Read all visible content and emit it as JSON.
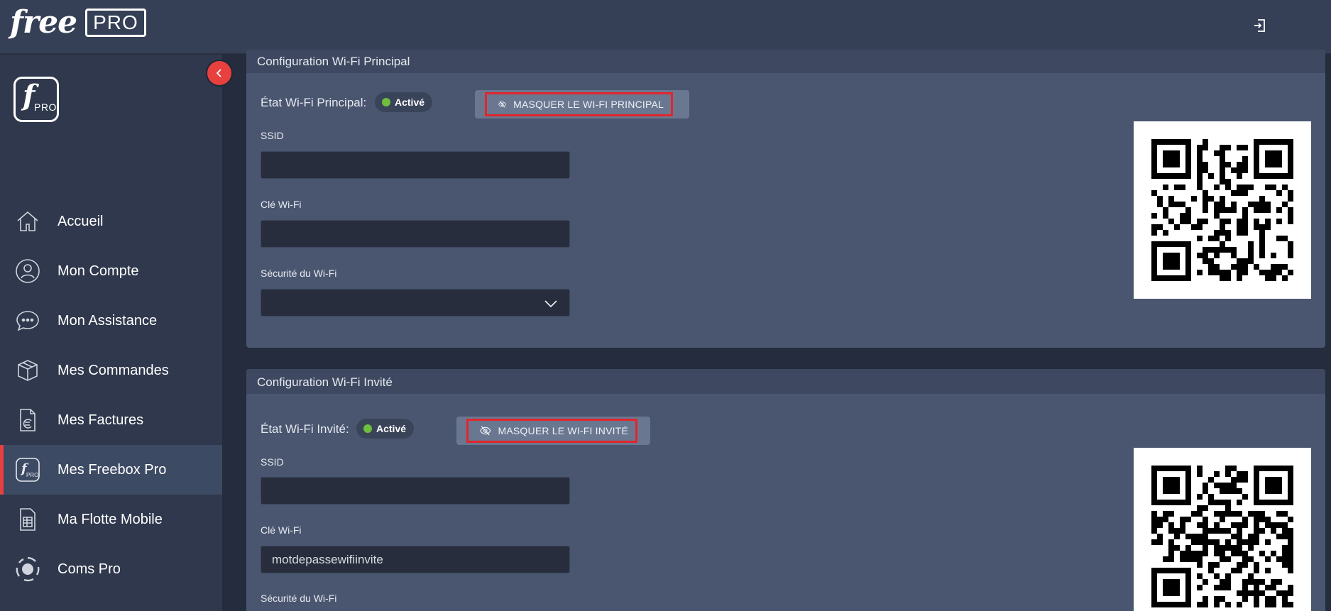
{
  "header": {
    "brand_free": "free",
    "brand_pro": "PRO",
    "logout_icon": "logout-icon"
  },
  "sidebar": {
    "logo_f": "f",
    "logo_pro": "PRO",
    "collapse_icon": "chevron-left-icon",
    "items": [
      {
        "label": "Accueil",
        "icon": "home-icon",
        "active": false
      },
      {
        "label": "Mon Compte",
        "icon": "user-icon",
        "active": false
      },
      {
        "label": "Mon Assistance",
        "icon": "chat-icon",
        "active": false
      },
      {
        "label": "Mes Commandes",
        "icon": "box-icon",
        "active": false
      },
      {
        "label": "Mes Factures",
        "icon": "invoice-euro-icon",
        "active": false
      },
      {
        "label": "Mes Freebox Pro",
        "icon": "freebox-pro-icon",
        "active": true
      },
      {
        "label": "Ma Flotte Mobile",
        "icon": "sim-card-icon",
        "active": false
      },
      {
        "label": "Coms Pro",
        "icon": "coms-icon",
        "active": false
      }
    ]
  },
  "wifi_principal": {
    "title": "Configuration Wi-Fi Principal",
    "state_label": "État Wi-Fi Principal:",
    "state_value": "Activé",
    "hide_button": "MASQUER LE WI-FI PRINCIPAL",
    "ssid_label": "SSID",
    "ssid_value": "",
    "key_label": "Clé Wi-Fi",
    "key_value": "",
    "security_label": "Sécurité du Wi-Fi",
    "security_value": ""
  },
  "wifi_invite": {
    "title": "Configuration Wi-Fi Invité",
    "state_label": "État Wi-Fi Invité:",
    "state_value": "Activé",
    "hide_button": "MASQUER LE WI-FI INVITÉ",
    "ssid_label": "SSID",
    "ssid_value": "",
    "key_label": "Clé Wi-Fi",
    "key_value": "motdepassewifiinvite",
    "security_label": "Sécurité du Wi-Fi"
  },
  "colors": {
    "accent_red": "#e8403f",
    "active_green": "#6fbf3e",
    "sidebar_bg": "#2f384c",
    "panel_bg": "#4a5670"
  }
}
